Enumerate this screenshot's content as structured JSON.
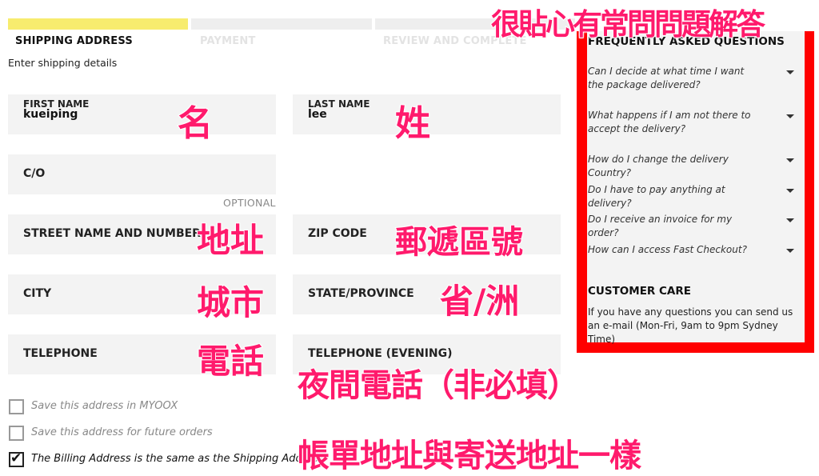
{
  "steps": [
    {
      "label": "SHIPPING ADDRESS",
      "active": true
    },
    {
      "label": "PAYMENT",
      "active": false
    },
    {
      "label": "REVIEW AND COMPLETE",
      "active": false
    }
  ],
  "subtitle": "Enter shipping details",
  "fields": {
    "first_name": {
      "label": "FIRST NAME",
      "value": "kueiping"
    },
    "last_name": {
      "label": "LAST NAME",
      "value": "lee"
    },
    "co": {
      "label": "C/O",
      "hint": "OPTIONAL"
    },
    "street": {
      "label": "STREET NAME AND NUMBER"
    },
    "zip": {
      "label": "ZIP CODE"
    },
    "city": {
      "label": "CITY"
    },
    "state": {
      "label": "STATE/PROVINCE"
    },
    "telephone": {
      "label": "TELEPHONE"
    },
    "telephone_evening": {
      "label": "TELEPHONE (EVENING)"
    }
  },
  "checkboxes": [
    {
      "label": "Save this address in MYOOX",
      "checked": false
    },
    {
      "label": "Save this address for future orders",
      "checked": false
    },
    {
      "label": "The Billing Address is the same as the Shipping Address",
      "checked": true
    }
  ],
  "faq": {
    "title": "FREQUENTLY ASKED QUESTIONS",
    "questions": [
      "Can I decide at what time I want the package delivered?",
      "What happens if I am not there to accept the delivery?",
      "How do I change the delivery Country?",
      "Do I have to pay anything at delivery?",
      "Do I receive an invoice for my order?",
      "How can I access Fast Checkout?"
    ]
  },
  "customer_care": {
    "title": "CUSTOMER CARE",
    "text": "If you have any questions you can send us an e-mail (Mon-Fri, 9am to 9pm Sydney Time)"
  },
  "annotations": {
    "faq": "很貼心有常問問題解答",
    "first_name": "名",
    "last_name": "姓",
    "street": "地址",
    "zip": "郵遞區號",
    "city": "城市",
    "state": "省/洲",
    "telephone": "電話",
    "telephone_evening": "夜間電話（非必填）",
    "billing": "帳單地址與寄送地址一樣"
  },
  "colors": {
    "active_step": "#f7ec6e",
    "inactive_step": "#eeeeee",
    "field_bg": "#f3f3f3",
    "annotation": "#ff1a6c",
    "highlight_border": "#ff0000"
  }
}
